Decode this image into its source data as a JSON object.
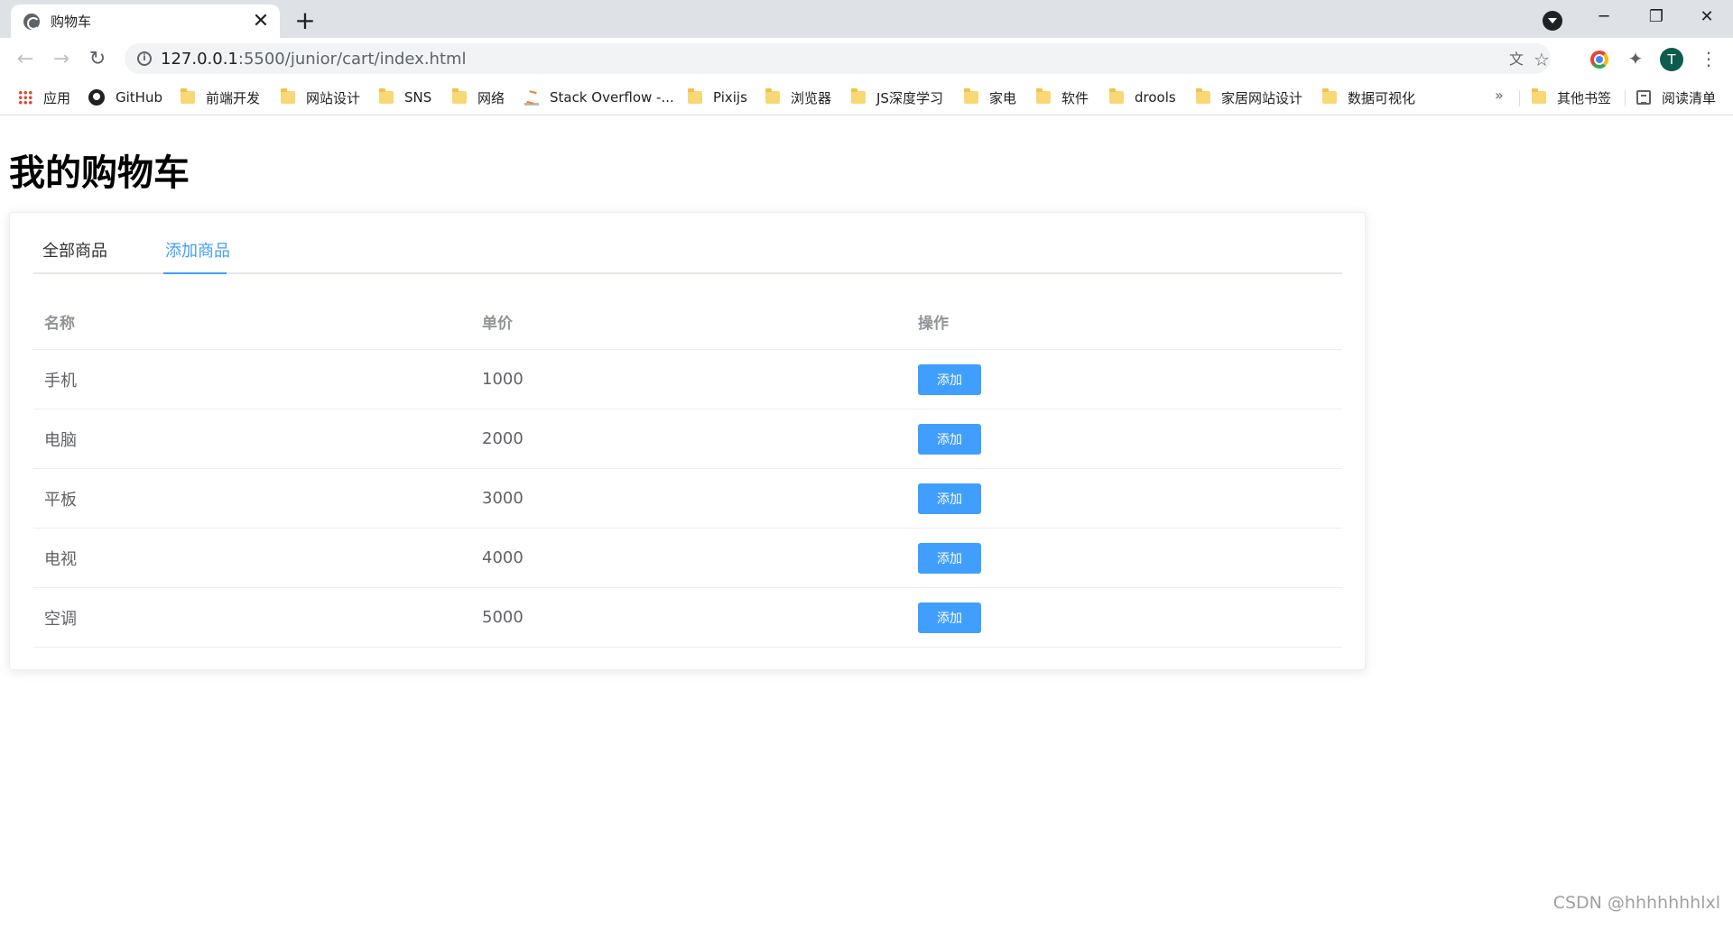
{
  "browser": {
    "tab_title": "购物车",
    "tab_close": "✕",
    "new_tab": "+",
    "url_host": "127.0.0.1",
    "url_path": ":5500/junior/cart/index.html",
    "avatar_letter": "T",
    "window": {
      "minimize": "─",
      "restore": "❐",
      "close": "✕"
    }
  },
  "bookmarks": [
    {
      "label": "应用",
      "icon": "apps-icon"
    },
    {
      "label": "GitHub",
      "icon": "github-icon"
    },
    {
      "label": "前端开发",
      "icon": "folder-icon"
    },
    {
      "label": "网站设计",
      "icon": "folder-icon"
    },
    {
      "label": "SNS",
      "icon": "folder-icon"
    },
    {
      "label": "网络",
      "icon": "folder-icon"
    },
    {
      "label": "Stack Overflow -...",
      "icon": "stackoverflow-icon"
    },
    {
      "label": "Pixijs",
      "icon": "folder-icon"
    },
    {
      "label": "浏览器",
      "icon": "folder-icon"
    },
    {
      "label": "JS深度学习",
      "icon": "folder-icon"
    },
    {
      "label": "家电",
      "icon": "folder-icon"
    },
    {
      "label": "软件",
      "icon": "folder-icon"
    },
    {
      "label": "drools",
      "icon": "folder-icon"
    },
    {
      "label": "家居网站设计",
      "icon": "folder-icon"
    },
    {
      "label": "数据可视化",
      "icon": "folder-icon"
    }
  ],
  "bookmarks_more": "»",
  "other_bookmarks": "其他书签",
  "reading_list": "阅读清单",
  "page": {
    "title": "我的购物车",
    "tabs": [
      {
        "label": "全部商品",
        "active": false
      },
      {
        "label": "添加商品",
        "active": true
      }
    ],
    "table": {
      "headers": [
        "名称",
        "单价",
        "操作"
      ],
      "rows": [
        {
          "name": "手机",
          "price": "1000",
          "action": "添加"
        },
        {
          "name": "电脑",
          "price": "2000",
          "action": "添加"
        },
        {
          "name": "平板",
          "price": "3000",
          "action": "添加"
        },
        {
          "name": "电视",
          "price": "4000",
          "action": "添加"
        },
        {
          "name": "空调",
          "price": "5000",
          "action": "添加"
        }
      ]
    }
  },
  "watermark": "CSDN @hhhhhhhlxl",
  "colors": {
    "accent": "#409eff",
    "tab_strip": "#dee1e6"
  }
}
